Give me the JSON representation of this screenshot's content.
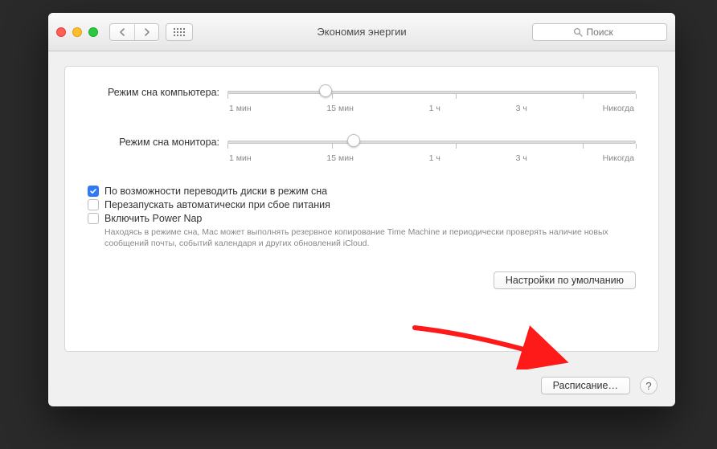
{
  "window": {
    "title": "Экономия энергии"
  },
  "search": {
    "placeholder": "Поиск"
  },
  "sliders": {
    "computer": {
      "label": "Режим сна компьютера:",
      "position_pct": 24
    },
    "display": {
      "label": "Режим сна монитора:",
      "position_pct": 31
    },
    "ticks": {
      "t1": "1 мин",
      "t2": "15 мин",
      "t3": "1 ч",
      "t4": "3 ч",
      "t5": "Никогда"
    }
  },
  "checks": {
    "disks": {
      "label": "По возможности переводить диски в режим сна",
      "checked": true
    },
    "restart": {
      "label": "Перезапускать автоматически при сбое питания",
      "checked": false
    },
    "nap": {
      "label": "Включить Power Nap",
      "checked": false
    }
  },
  "nap_help": "Находясь в режиме сна, Mac может выполнять резервное копирование Time Machine и периодически проверять наличие новых сообщений почты, событий календаря и других обновлений iCloud.",
  "buttons": {
    "defaults": "Настройки по умолчанию",
    "schedule": "Расписание…",
    "help": "?"
  }
}
